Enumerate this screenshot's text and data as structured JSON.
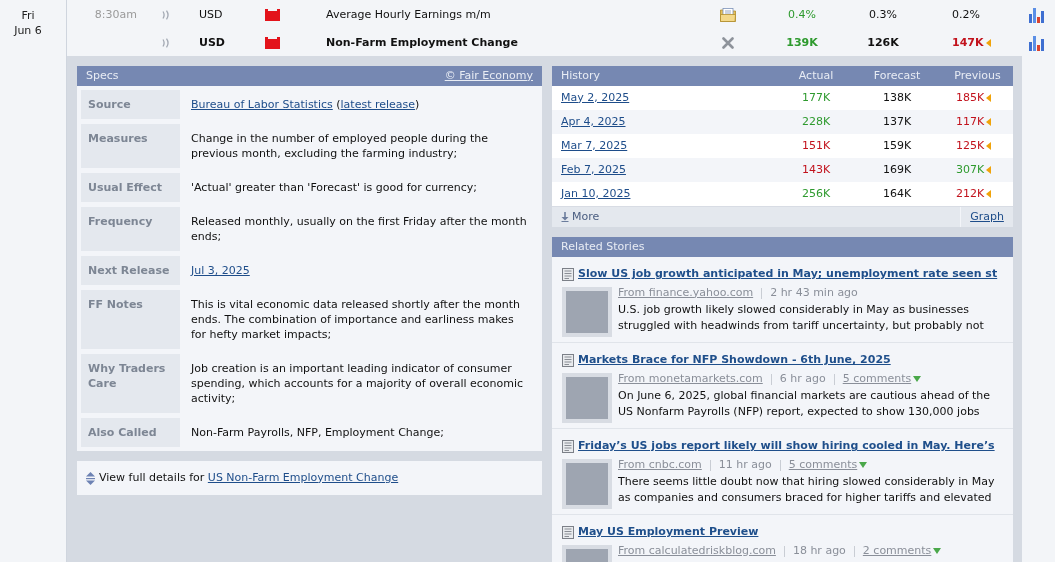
{
  "calendar": {
    "date": {
      "weekday": "Fri",
      "day": "Jun 6"
    },
    "events": [
      {
        "time": "8:30am",
        "currency": "USD",
        "impact": {
          "color": "#e3131b"
        },
        "title": "Average Hourly Earnings m/m",
        "expanded": false,
        "actual": "0.4%",
        "actual_better": true,
        "forecast": "0.3%",
        "previous": "0.2%",
        "revised": false
      },
      {
        "currency": "USD",
        "impact": {
          "color": "#e3131b"
        },
        "title": "Non-Farm Employment Change",
        "expanded": true,
        "actual": "139K",
        "actual_better": true,
        "forecast": "126K",
        "previous": "147K",
        "revised": true,
        "previous_better": false
      }
    ]
  },
  "specs": {
    "title": "Specs",
    "credit": "© Fair Economy",
    "rows": [
      {
        "label": "Source",
        "parts": [
          {
            "kind": "link",
            "text": "Bureau of Labor Statistics"
          },
          {
            "kind": "text",
            "text": " ("
          },
          {
            "kind": "link",
            "text": "latest release"
          },
          {
            "kind": "text",
            "text": ")"
          }
        ]
      },
      {
        "label": "Measures",
        "value": "Change in the number of employed people during the previous month, excluding the farming industry;"
      },
      {
        "label": "Usual Effect",
        "value": "'Actual' greater than 'Forecast' is good for currency;"
      },
      {
        "label": "Frequency",
        "value": "Released monthly, usually on the first Friday after the month ends;"
      },
      {
        "label": "Next Release",
        "parts": [
          {
            "kind": "link",
            "text": "Jul 3, 2025"
          }
        ]
      },
      {
        "label": "FF Notes",
        "value": "This is vital economic data released shortly after the month ends. The combination of importance and earliness makes for hefty market impacts;"
      },
      {
        "label": "Why Traders Care",
        "value": "Job creation is an important leading indicator of consumer spending, which accounts for a majority of overall economic activity;"
      },
      {
        "label": "Also Called",
        "value": "Non-Farm Payrolls, NFP, Employment Change;"
      }
    ]
  },
  "view_details": {
    "text": "View full details for",
    "link": "US Non-Farm Employment Change"
  },
  "history": {
    "columns": [
      "History",
      "Actual",
      "Forecast",
      "Previous"
    ],
    "rows": [
      {
        "date": "May 2, 2025",
        "actual": "177K",
        "actual_better": true,
        "forecast": "138K",
        "previous": "185K",
        "revised": true,
        "previous_better": false
      },
      {
        "date": "Apr 4, 2025",
        "actual": "228K",
        "actual_better": true,
        "forecast": "137K",
        "previous": "117K",
        "revised": true,
        "previous_better": false
      },
      {
        "date": "Mar 7, 2025",
        "actual": "151K",
        "actual_better": false,
        "forecast": "159K",
        "previous": "125K",
        "revised": true,
        "previous_better": false
      },
      {
        "date": "Feb 7, 2025",
        "actual": "143K",
        "actual_better": false,
        "forecast": "169K",
        "previous": "307K",
        "revised": true,
        "previous_better": true
      },
      {
        "date": "Jan 10, 2025",
        "actual": "256K",
        "actual_better": true,
        "forecast": "164K",
        "previous": "212K",
        "revised": true,
        "previous_better": false
      }
    ],
    "more": "More",
    "graph": "Graph"
  },
  "related": {
    "title": "Related Stories",
    "stories": [
      {
        "title": "Slow US job growth anticipated in May; unemployment rate seen st",
        "source": "From finance.yahoo.com",
        "time": "2 hr 43 min ago",
        "summary": "U.S. job growth likely slowed considerably in May as businesses struggled with headwinds from tariff uncertainty, but probably not"
      },
      {
        "title": "Markets Brace for NFP Showdown - 6th June, 2025",
        "source": "From monetamarkets.com",
        "time": "6 hr ago",
        "comments": "5 comments",
        "summary": "On June 6, 2025, global financial markets are cautious ahead of the US Nonfarm Payrolls (NFP) report, expected to show 130,000 jobs"
      },
      {
        "title": "Friday’s US jobs report likely will show hiring cooled in May. Here’s",
        "source": "From cnbc.com",
        "time": "11 hr ago",
        "comments": "5 comments",
        "summary": "There seems little doubt now that hiring slowed considerably in May as companies and consumers braced for higher tariffs and elevated"
      },
      {
        "title": "May US Employment Preview",
        "source": "From calculatedriskblog.com",
        "time": "18 hr ago",
        "comments": "2 comments"
      }
    ]
  }
}
